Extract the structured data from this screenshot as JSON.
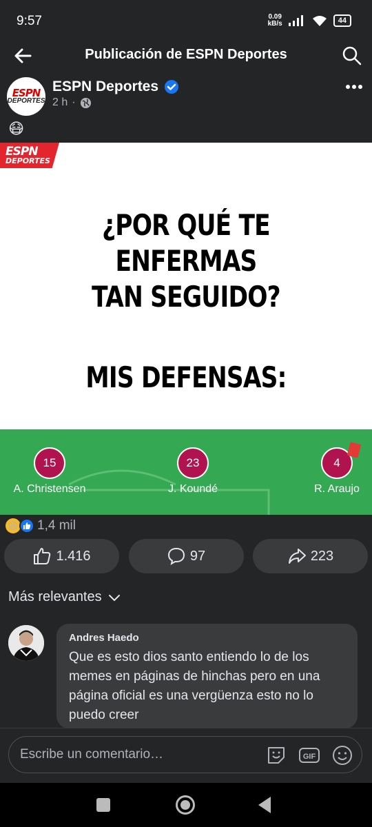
{
  "status_bar": {
    "time": "9:57",
    "net_speed_value": "0.09",
    "net_speed_unit": "kB/s",
    "battery": "44"
  },
  "header": {
    "title": "Publicación de ESPN Deportes"
  },
  "post": {
    "author": "ESPN Deportes",
    "time_ago": "2 h",
    "separator": "·",
    "emoji": "😷",
    "avatar_logo_top": "ESPN",
    "avatar_logo_bottom": "DEPORTES"
  },
  "image": {
    "logo_top": "ESPN",
    "logo_bottom": "DEPORTES",
    "question_line1": "¿POR QUÉ TE ENFERMAS",
    "question_line2": "TAN SEGUIDO?",
    "answer": "MIS DEFENSAS:",
    "players": [
      {
        "number": "15",
        "name": "A. Christensen"
      },
      {
        "number": "23",
        "name": "J. Koundé"
      },
      {
        "number": "4",
        "name": "R. Araujo"
      }
    ]
  },
  "reactions": {
    "total": "1,4 mil"
  },
  "actions": {
    "likes": "1.416",
    "comments": "97",
    "shares": "223"
  },
  "comments_section": {
    "sort_label": "Más relevantes",
    "items": [
      {
        "author": "Andres Haedo",
        "text": "Que es esto dios santo entiendo lo de los memes en páginas de hinchas pero en una página oficial es una vergüenza esto no lo puedo creer"
      }
    ]
  },
  "composer": {
    "placeholder": "Escribe un comentario…",
    "gif_label": "GIF"
  },
  "colors": {
    "background": "#242526",
    "accent_blue": "#1877f2",
    "pitch_green": "#34a853",
    "player_badge": "#b0134d",
    "espn_red": "#e4252d"
  }
}
